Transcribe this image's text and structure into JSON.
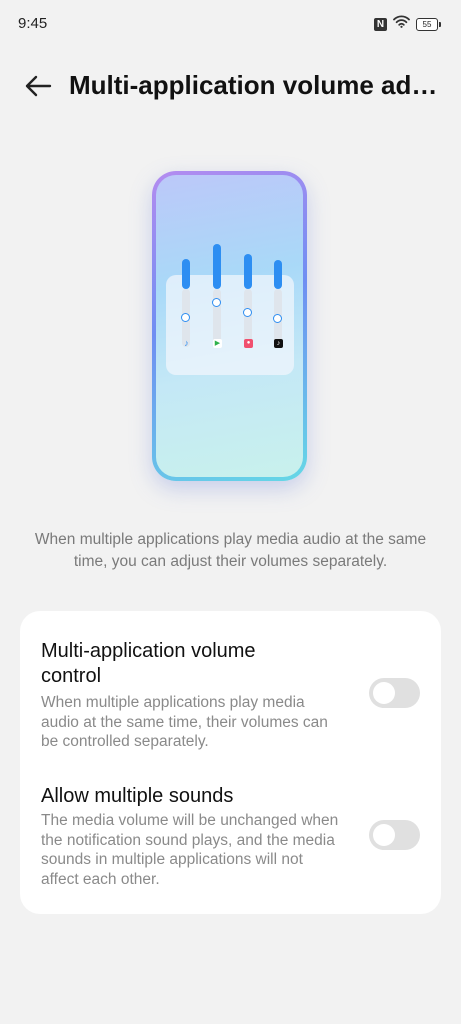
{
  "status_bar": {
    "time": "9:45",
    "nfc_label": "N",
    "battery_level": "55",
    "icons": [
      "nfc-icon",
      "wifi-icon",
      "battery-icon"
    ]
  },
  "header": {
    "back_icon": "arrow-left-icon",
    "title": "Multi-application volume adj…"
  },
  "illustration": {
    "mixer_levels": [
      0.52,
      0.78,
      0.6,
      0.5
    ],
    "app_icons": [
      "music-note-icon",
      "play-icon",
      "app-icon",
      "tiktok-icon"
    ],
    "colors": {
      "accent": "#2d8ef2",
      "frame_start": "#b48cf0",
      "frame_end": "#65d8e6"
    }
  },
  "description": "When multiple applications play media audio at the same time, you can adjust their volumes separately.",
  "settings": [
    {
      "title": "Multi-application volume control",
      "description": "When multiple applications play media audio at the same time, their volumes can be controlled separately.",
      "enabled": false
    },
    {
      "title": "Allow multiple sounds",
      "description": "The media volume will be unchanged when the notification sound plays, and the media sounds in multiple applications will not affect each other.",
      "enabled": false
    }
  ]
}
